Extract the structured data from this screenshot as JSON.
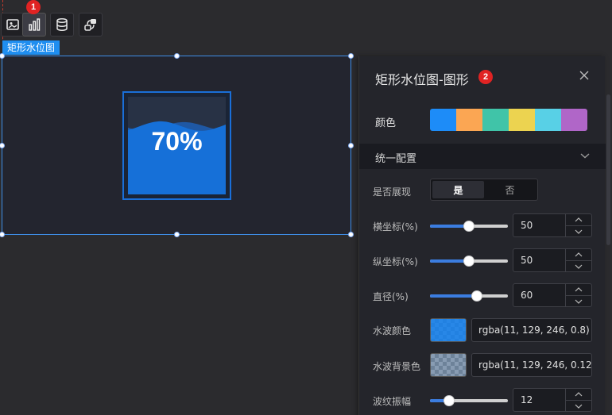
{
  "markers": {
    "toolbar": "1",
    "panel": "2"
  },
  "toolbar": {
    "buttons": [
      {
        "icon": "image-icon"
      },
      {
        "icon": "bar-chart-icon",
        "active": true
      },
      {
        "icon": "database-icon"
      },
      {
        "icon": "interaction-icon"
      }
    ]
  },
  "component": {
    "tag": "矩形水位图",
    "label": "70%",
    "level": 0.7
  },
  "panel": {
    "title": "矩形水位图-图形",
    "color_label": "颜色",
    "palette": [
      "#1d8cf8",
      "#fba653",
      "#40c4a8",
      "#ecd350",
      "#58d0e6",
      "#b066c8"
    ],
    "section": "统一配置",
    "show_label": "是否展现",
    "show_yes": "是",
    "show_no": "否",
    "x_label": "横坐标(%)",
    "x_value": "50",
    "y_label": "纵坐标(%)",
    "y_value": "50",
    "diameter_label": "直径(%)",
    "diameter_value": "60",
    "wave_color_label": "水波颜色",
    "wave_color_value": "rgba(11, 129, 246, 0.8)",
    "wave_bg_label": "水波背景色",
    "wave_bg_value": "rgba(11, 129, 246, 0.12",
    "amplitude_label": "波纹振幅",
    "amplitude_value": "12"
  },
  "colors": {
    "accent": "#1f8ef0",
    "wave": "#0b81f6",
    "marker": "#e02323"
  }
}
